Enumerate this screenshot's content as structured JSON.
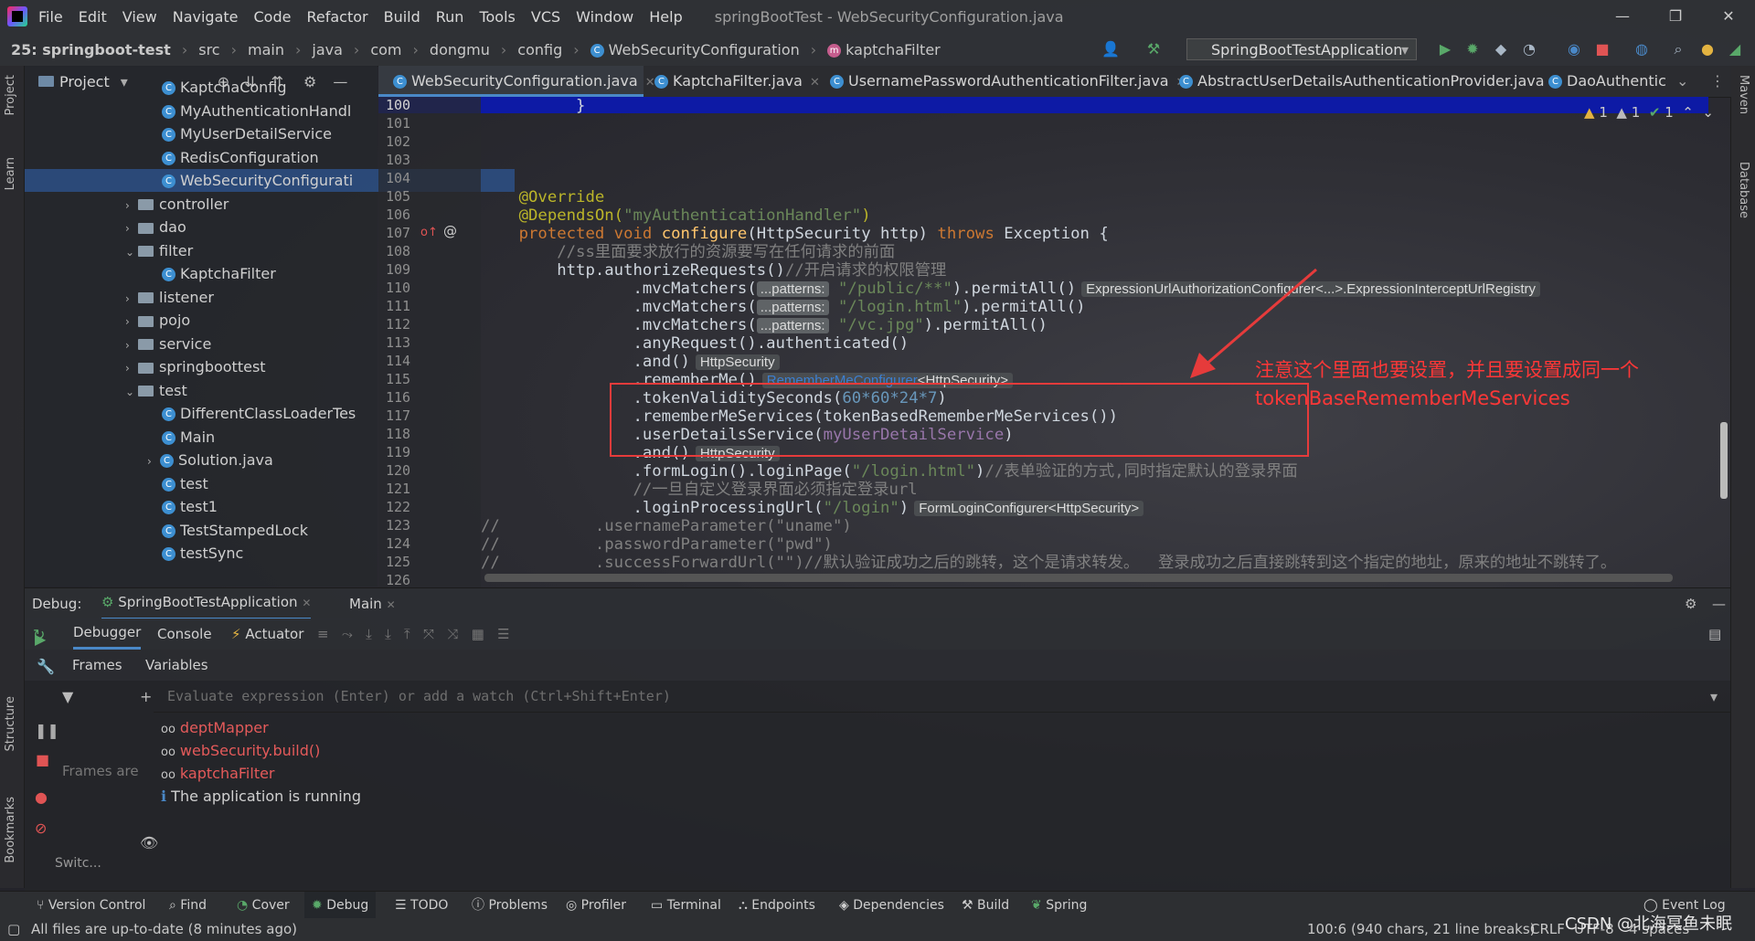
{
  "window": {
    "title": "springBootTest - WebSecurityConfiguration.java",
    "menu": [
      "File",
      "Edit",
      "View",
      "Navigate",
      "Code",
      "Refactor",
      "Build",
      "Run",
      "Tools",
      "VCS",
      "Window",
      "Help"
    ]
  },
  "breadcrumb": {
    "project": "25: springboot-test",
    "parts": [
      "src",
      "main",
      "java",
      "com",
      "dongmu",
      "config",
      "WebSecurityConfiguration",
      "kaptchaFilter"
    ]
  },
  "run_config": "SpringBootTestApplication",
  "project_panel": {
    "title": "Project",
    "items": [
      {
        "label": "KaptchaConfig",
        "kind": "class"
      },
      {
        "label": "MyAuthenticationHandl",
        "kind": "class"
      },
      {
        "label": "MyUserDetailService",
        "kind": "class"
      },
      {
        "label": "RedisConfiguration",
        "kind": "class"
      },
      {
        "label": "WebSecurityConfigurati",
        "kind": "class",
        "selected": true
      },
      {
        "label": "controller",
        "kind": "folder"
      },
      {
        "label": "dao",
        "kind": "folder"
      },
      {
        "label": "filter",
        "kind": "folder",
        "open": true
      },
      {
        "label": "KaptchaFilter",
        "kind": "class"
      },
      {
        "label": "listener",
        "kind": "folder"
      },
      {
        "label": "pojo",
        "kind": "folder"
      },
      {
        "label": "service",
        "kind": "folder"
      },
      {
        "label": "springboottest",
        "kind": "folder"
      },
      {
        "label": "test",
        "kind": "folder",
        "open": true
      },
      {
        "label": "DifferentClassLoaderTes",
        "kind": "class"
      },
      {
        "label": "Main",
        "kind": "class"
      },
      {
        "label": "Solution.java",
        "kind": "class"
      },
      {
        "label": "test",
        "kind": "class"
      },
      {
        "label": "test1",
        "kind": "class"
      },
      {
        "label": "TestStampedLock",
        "kind": "class"
      },
      {
        "label": "testSync",
        "kind": "class"
      }
    ]
  },
  "tabs": [
    "WebSecurityConfiguration.java",
    "KaptchaFilter.java",
    "UsernamePasswordAuthenticationFilter.java",
    "AbstractUserDetailsAuthenticationProvider.java",
    "DaoAuthentic"
  ],
  "line_numbers": [
    "100",
    "101",
    "102",
    "103",
    "104",
    "105",
    "106",
    "107",
    "108",
    "109",
    "110",
    "111",
    "112",
    "113",
    "114",
    "115",
    "116",
    "117",
    "118",
    "119",
    "120",
    "121",
    "122",
    "123",
    "124",
    "125",
    "126"
  ],
  "code": {
    "l100": "}",
    "l105": "@Override",
    "l106a": "@DependsOn(",
    "l106b": "\"myAuthenticationHandler\"",
    "l106c": ")",
    "l107a": "protected void ",
    "l107b": "configure",
    "l107c": "(HttpSecurity http) ",
    "l107d": "throws",
    "l107e": " Exception {",
    "l108": "//ss里面要求放行的资源要写在任何请求的前面",
    "l109a": "http.authorizeRequests()",
    "l109b": "//开启请求的权限管理",
    "l110a": ".mvcMatchers(",
    "hint_patterns": "...patterns:",
    "l110b": "\"/public/**\"",
    "l110c": ").permitAll()",
    "l110hint": "ExpressionUrlAuthorizationConfigurer<...>.ExpressionInterceptUrlRegistry",
    "l111b": "\"/login.html\"",
    "l111c": ").permitAll()",
    "l112b": "\"/vc.jpg\"",
    "l112c": ").permitAll()",
    "l113": ".anyRequest().authenticated()",
    "l114": ".and()",
    "l114hint": "HttpSecurity",
    "l115": ".rememberMe()",
    "l115hint_a": "RememberMeConfigurer",
    "l115hint_b": "<HttpSecurity>",
    "l116a": ".tokenValiditySeconds(",
    "l116b": "60*60*24*7",
    "l116c": ")",
    "l117": ".rememberMeServices(tokenBasedRememberMeServices())",
    "l118a": ".userDetailsService(",
    "l118b": "myUserDetailService",
    "l118c": ")",
    "l119": ".and()",
    "l119hint": "HttpSecurity",
    "l120a": ".formLogin().loginPage(",
    "l120b": "\"/login.html\"",
    "l120c": ")",
    "l120d": "//表单验证的方式,同时指定默认的登录界面",
    "l121": "//一旦自定义登录界面必须指定登录url",
    "l122a": ".loginProcessingUrl(",
    "l122b": "\"/login\"",
    "l122c": ")",
    "l122hint": "FormLoginConfigurer<HttpSecurity>",
    "l123": "//          .usernameParameter(\"uname\")",
    "l124": "//          .passwordParameter(\"pwd\")",
    "l125": "//          .successForwardUrl(\"\")//默认验证成功之后的跳转，这个是请求转发。  登录成功之后直接跳转到这个指定的地址，原来的地址不跳转了。"
  },
  "inspection": {
    "warn1": "1",
    "warn2": "1",
    "ok": "1"
  },
  "annotation": {
    "line1": "注意这个里面也要设置，并且要设置成同一个",
    "line2": "tokenBaseRememberMeServices",
    "color": "#ff3737"
  },
  "debug": {
    "label": "Debug:",
    "session_tab": "SpringBootTestApplication",
    "main_tab": "Main",
    "sub_tabs": [
      "Debugger",
      "Console",
      "Actuator"
    ],
    "frames_label": "Frames",
    "variables_label": "Variables",
    "eval_placeholder": "Evaluate expression (Enter) or add a watch (Ctrl+Shift+Enter)",
    "frames_msg": "Frames are",
    "switch_label": "Switc...",
    "watches": [
      "deptMapper",
      "webSecurity.build()",
      "kaptchaFilter"
    ],
    "info": "The application is running"
  },
  "bottom_tools": [
    "Version Control",
    "Find",
    "Cover",
    "Debug",
    "TODO",
    "Problems",
    "Profiler",
    "Terminal",
    "Endpoints",
    "Dependencies",
    "Build",
    "Spring",
    "Event Log"
  ],
  "status": {
    "left": "All files are up-to-date (8 minutes ago)",
    "position": "100:6 (940 chars, 21 line breaks)",
    "crlf": "CRLF",
    "encoding": "UTF-8",
    "indent": "4 spaces",
    "watermark": "CSDN @北海冥鱼未眠"
  },
  "side_labels": {
    "project": "Project",
    "learn": "Learn",
    "structure": "Structure",
    "bookmarks": "Bookmarks",
    "maven": "Maven",
    "database": "Database"
  }
}
